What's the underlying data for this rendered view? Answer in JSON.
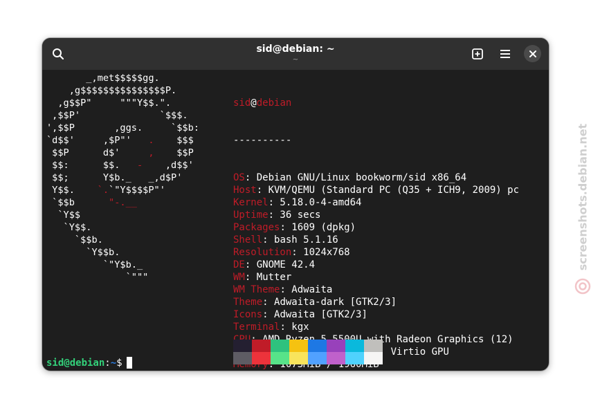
{
  "window": {
    "title": "sid@debian: ~",
    "subtitle": "~"
  },
  "icons": {
    "search": "search-icon",
    "new_tab": "new-tab-icon",
    "menu": "hamburger-menu-icon",
    "close": "close-icon"
  },
  "logo": [
    {
      "white": "       _,met$$$$$gg.",
      "red": ""
    },
    {
      "white": "    ,g$$$$$$$$$$$$$$$P.",
      "red": ""
    },
    {
      "white": "  ,g$$P\"     \"\"\"Y$$.\".",
      "red": ""
    },
    {
      "white": " ,$$P'              `$$$.",
      "red": ""
    },
    {
      "white": "',$$P       ,ggs.     `$$b:",
      "red": ""
    },
    {
      "white": "`d$$'     ,$P\"'   ",
      "red": ".",
      "tail": "    $$$"
    },
    {
      "white": " $$P      d$'     ",
      "red": ",",
      "tail": "    $$P"
    },
    {
      "white": " $$:      $$.   ",
      "red": "-",
      "tail": "    ,d$$'"
    },
    {
      "white": " $$;      Y$b._   _,d$P'",
      "red": ""
    },
    {
      "white": " Y$$.    ",
      "red": "`.",
      "tail": "`\"Y$$$$P\"'"
    },
    {
      "white": " `$$b      ",
      "red": "\"-.__",
      "tail": ""
    },
    {
      "white": "  `Y$$",
      "red": ""
    },
    {
      "white": "   `Y$$.",
      "red": ""
    },
    {
      "white": "     `$$b.",
      "red": ""
    },
    {
      "white": "       `Y$$b.",
      "red": ""
    },
    {
      "white": "          `\"Y$b._",
      "red": ""
    },
    {
      "white": "              `\"\"\"",
      "red": ""
    }
  ],
  "info": {
    "user": "sid",
    "at": "@",
    "host": "debian",
    "separator": "----------",
    "fields": [
      {
        "key": "OS",
        "value": ": Debian GNU/Linux bookworm/sid x86_64"
      },
      {
        "key": "Host",
        "value": ": KVM/QEMU (Standard PC (Q35 + ICH9, 2009) pc"
      },
      {
        "key": "Kernel",
        "value": ": 5.18.0-4-amd64"
      },
      {
        "key": "Uptime",
        "value": ": 36 secs"
      },
      {
        "key": "Packages",
        "value": ": 1609 (dpkg)"
      },
      {
        "key": "Shell",
        "value": ": bash 5.1.16"
      },
      {
        "key": "Resolution",
        "value": ": 1024x768"
      },
      {
        "key": "DE",
        "value": ": GNOME 42.4"
      },
      {
        "key": "WM",
        "value": ": Mutter"
      },
      {
        "key": "WM Theme",
        "value": ": Adwaita"
      },
      {
        "key": "Theme",
        "value": ": Adwaita-dark [GTK2/3]"
      },
      {
        "key": "Icons",
        "value": ": Adwaita [GTK2/3]"
      },
      {
        "key": "Terminal",
        "value": ": kgx"
      },
      {
        "key": "CPU",
        "value": ": AMD Ryzen 5 5500U with Radeon Graphics (12)"
      },
      {
        "key": "GPU",
        "value": ": 00:01.0 Red Hat, Inc. Virtio GPU"
      },
      {
        "key": "Memory",
        "value": ": 1073MiB / 1960MiB"
      }
    ]
  },
  "palette": {
    "row1": [
      "#241f31",
      "#c01c28",
      "#2ec27e",
      "#f5c211",
      "#1e78e4",
      "#9841bb",
      "#0ab9dc",
      "#c0bfbc"
    ],
    "row2": [
      "#5e5c64",
      "#ed333b",
      "#57e389",
      "#f8e45c",
      "#51a1ff",
      "#c061cb",
      "#4fd2fd",
      "#f6f5f4"
    ]
  },
  "prompt": {
    "userhost": "sid@debian",
    "colon": ":",
    "path": "~",
    "symbol": "$"
  },
  "watermark": {
    "text": "screenshots.debian.net"
  }
}
